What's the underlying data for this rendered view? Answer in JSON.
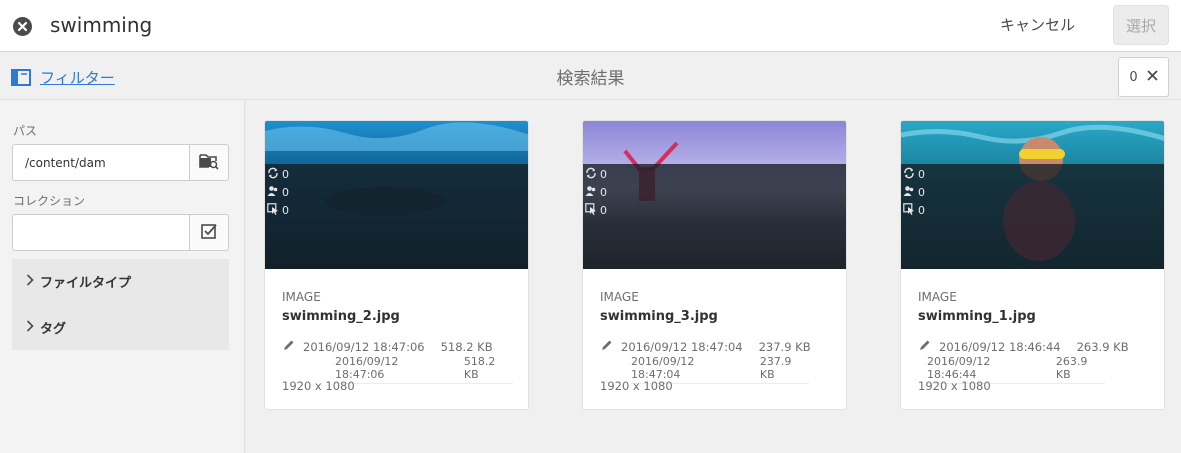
{
  "search": {
    "query": "swimming"
  },
  "actions": {
    "cancel_label": "キャンセル",
    "select_label": "選択"
  },
  "rail_header": {
    "filter_label": "フィルター",
    "results_title": "検索結果",
    "selected_count": "0"
  },
  "filters": {
    "path_label": "パス",
    "path_value": "/content/dam",
    "collection_label": "コレクション",
    "collection_value": "",
    "sections": [
      "ファイルタイプ",
      "タグ"
    ]
  },
  "cards": [
    {
      "type": "IMAGE",
      "name": "swimming_2.jpg",
      "modified": "2016/09/12 18:47:06",
      "size": "518.2 KB",
      "dimensions": "1920 x 1080",
      "stats": [
        "0",
        "0",
        "0"
      ]
    },
    {
      "type": "IMAGE",
      "name": "swimming_3.jpg",
      "modified": "2016/09/12 18:47:04",
      "size": "237.9 KB",
      "dimensions": "1920 x 1080",
      "stats": [
        "0",
        "0",
        "0"
      ]
    },
    {
      "type": "IMAGE",
      "name": "swimming_1.jpg",
      "modified": "2016/09/12 18:46:44",
      "size": "263.9 KB",
      "dimensions": "1920 x 1080",
      "stats": [
        "0",
        "0",
        "0"
      ]
    }
  ],
  "icons": {
    "clear": "close-circle-icon",
    "panel": "rail-panel-icon",
    "browse": "folder-search-icon",
    "collection": "checkbox-icon",
    "chevron": "chevron-right-icon",
    "edit": "pencil-icon",
    "sync": "sync-icon",
    "users": "users-icon",
    "pointer": "pointer-icon"
  },
  "colors": {
    "accent": "#2d7ad2",
    "overlay": "#161e24"
  }
}
